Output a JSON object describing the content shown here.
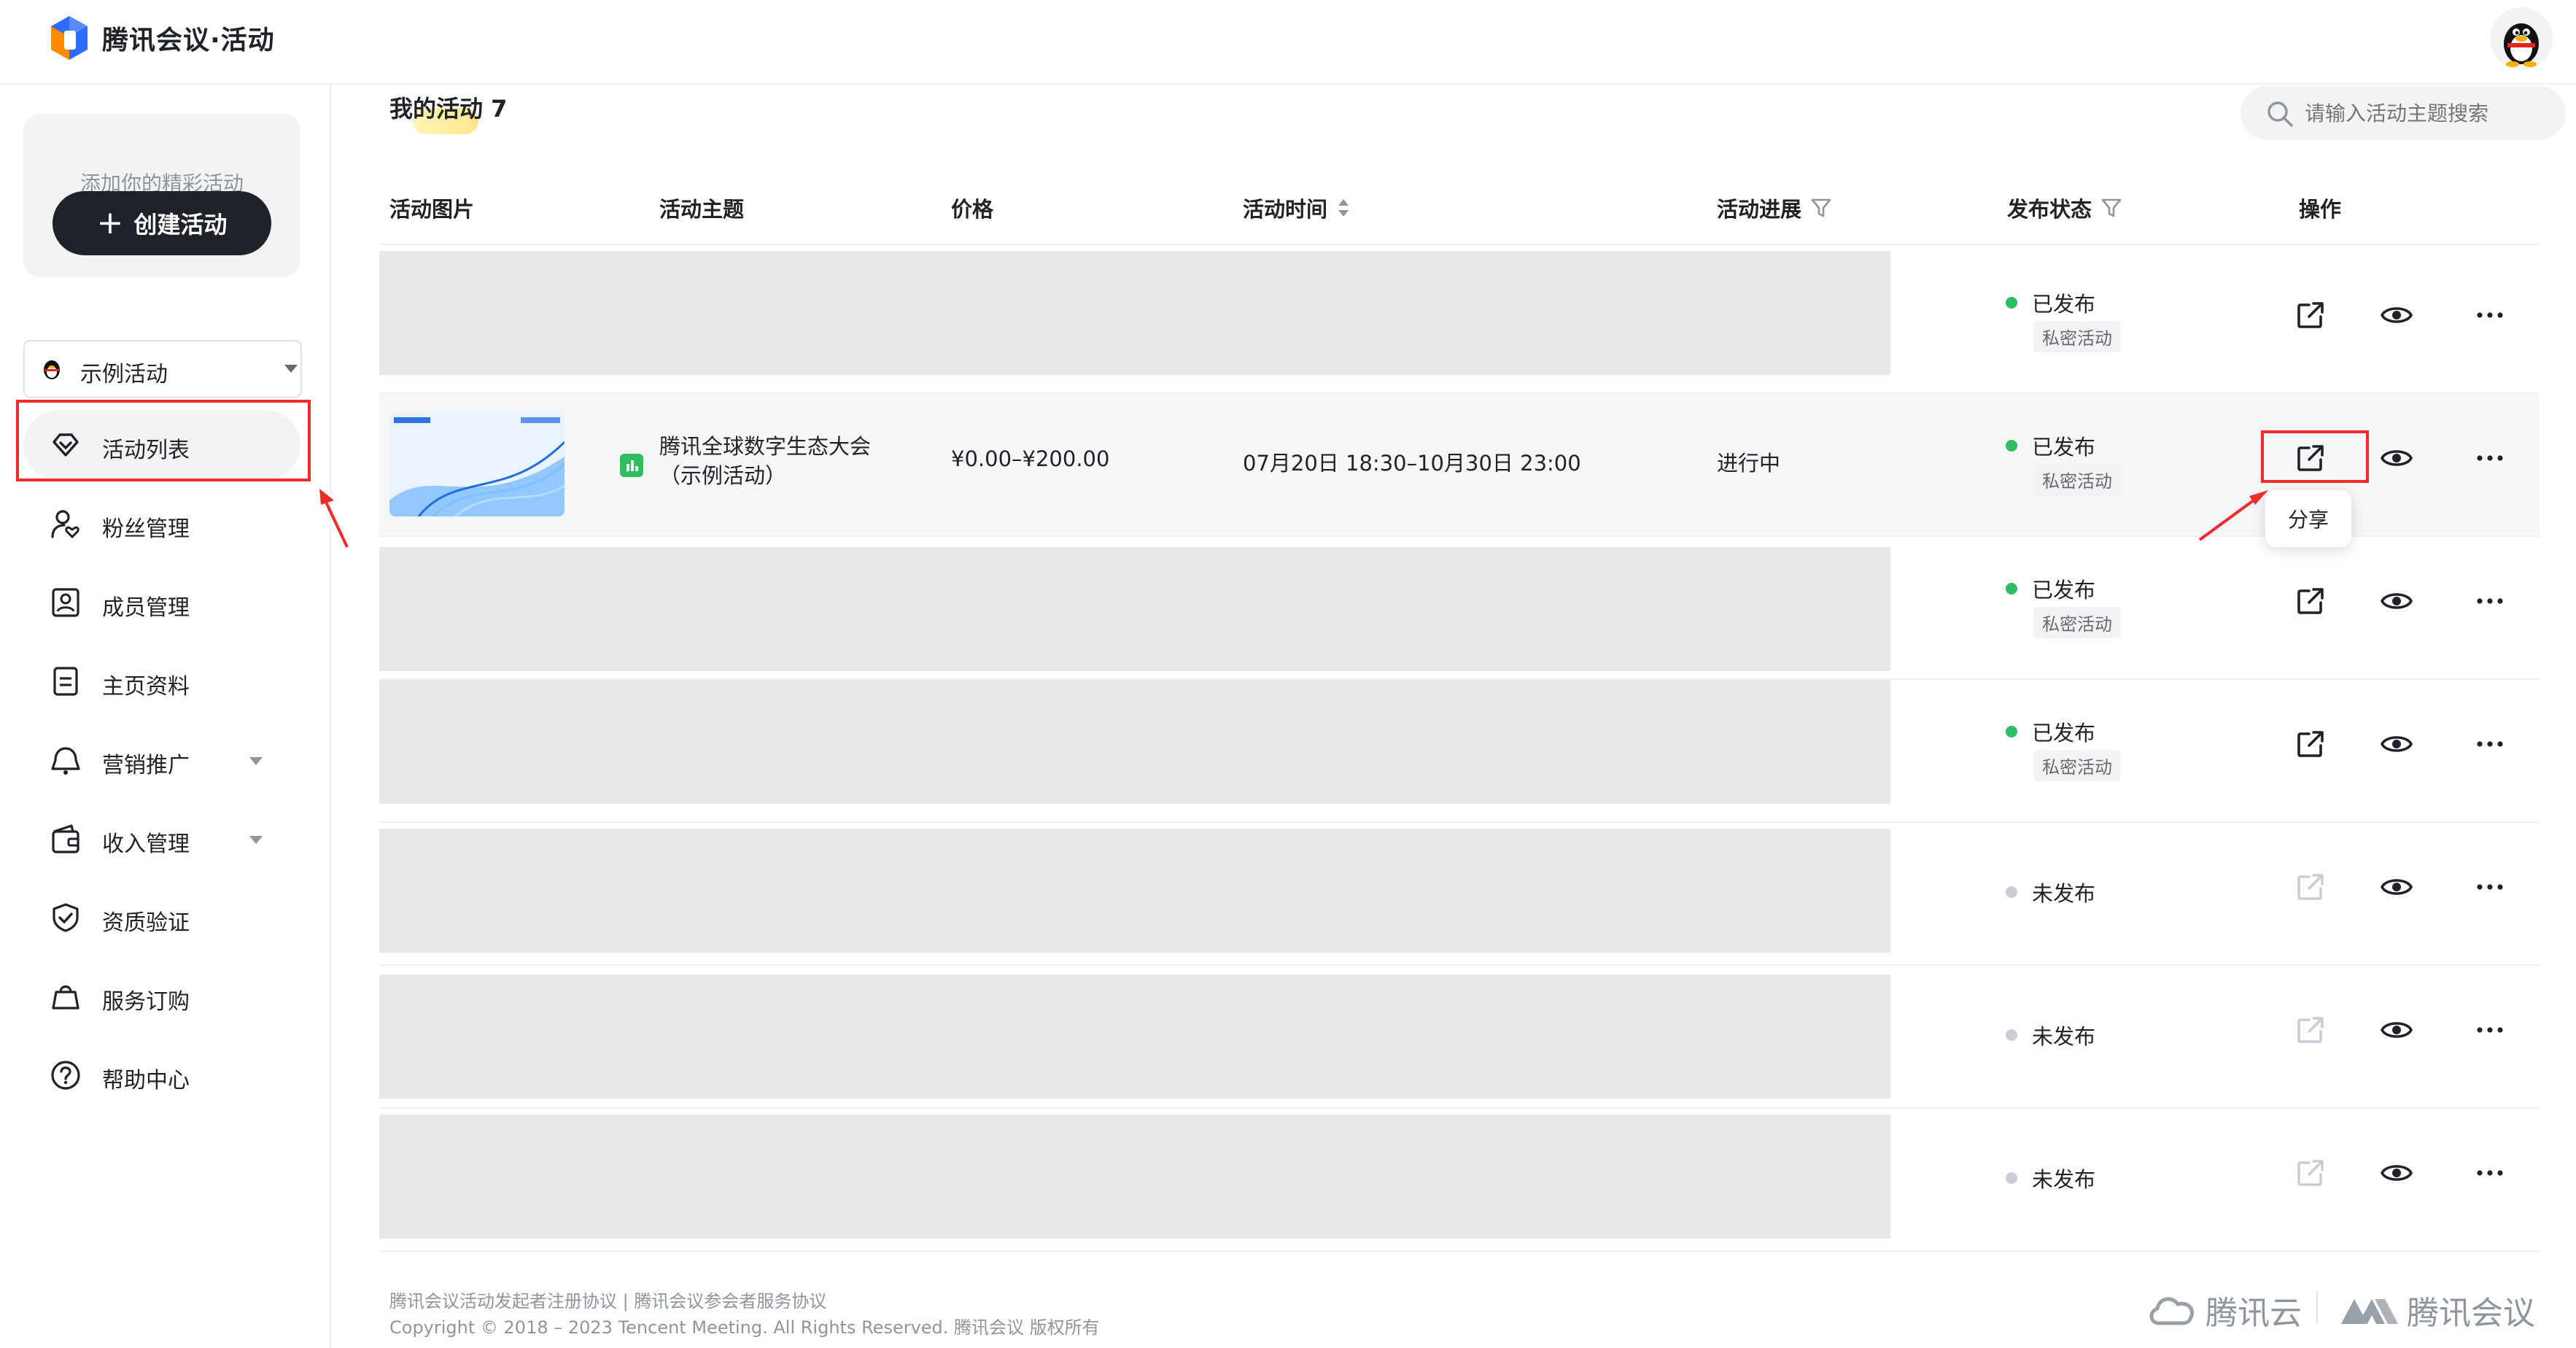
{
  "app": {
    "title": "腾讯会议·活动"
  },
  "sidebar": {
    "create_hint": "添加你的精彩活动",
    "create_label": "创建活动",
    "selector_value": "示例活动",
    "items": [
      {
        "label": "活动列表",
        "icon": "diamond-icon"
      },
      {
        "label": "粉丝管理",
        "icon": "user-heart-icon"
      },
      {
        "label": "成员管理",
        "icon": "member-card-icon"
      },
      {
        "label": "主页资料",
        "icon": "document-icon"
      },
      {
        "label": "营销推广",
        "icon": "megaphone-icon"
      },
      {
        "label": "收入管理",
        "icon": "wallet-icon"
      },
      {
        "label": "资质验证",
        "icon": "shield-check-icon"
      },
      {
        "label": "服务订购",
        "icon": "shopping-bag-icon"
      },
      {
        "label": "帮助中心",
        "icon": "help-circle-icon"
      }
    ]
  },
  "main": {
    "title": "我的活动 7",
    "search_placeholder": "请输入活动主题搜索",
    "columns": [
      "活动图片",
      "活动主题",
      "价格",
      "活动时间",
      "活动进展",
      "发布状态",
      "操作"
    ],
    "rows": [
      {
        "status": "已发布",
        "tag": "私密活动",
        "published": true
      },
      {
        "status": "已发布",
        "tag": "私密活动",
        "published": true,
        "topic": "腾讯全球数字生态大会",
        "topic_line2": "（示例活动）",
        "price": "¥0.00–¥200.00",
        "time": "07月20日 18:30–10月30日 23:00",
        "progress": "进行中",
        "thumb_caption": "腾讯全球数字生态大会"
      },
      {
        "status": "已发布",
        "tag": "私密活动",
        "published": true
      },
      {
        "status": "已发布",
        "tag": "私密活动",
        "published": true
      },
      {
        "status": "未发布",
        "published": false
      },
      {
        "status": "未发布",
        "published": false
      },
      {
        "status": "未发布",
        "published": false
      }
    ],
    "tooltip": "分享"
  },
  "footer": {
    "links": "腾讯会议活动发起者注册协议 | 腾讯会议参会者服务协议",
    "copyright": "Copyright © 2018 – 2023 Tencent Meeting. All Rights Reserved. 腾讯会议 版权所有",
    "brand1": "腾讯云",
    "brand2": "腾讯会议"
  },
  "colors": {
    "published": "#2dbe62",
    "unpublished": "#c9cdd4",
    "highlight": "#ee2c2c"
  }
}
